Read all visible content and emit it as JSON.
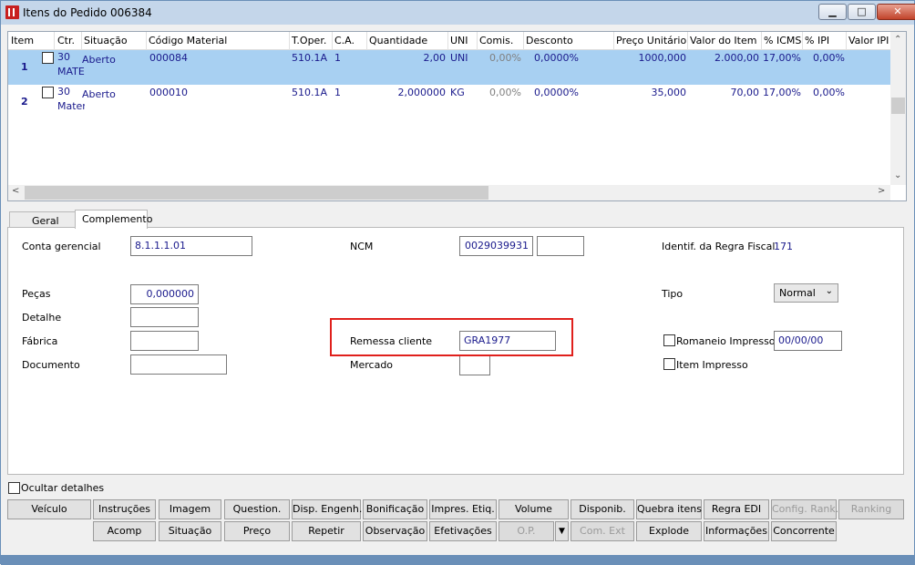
{
  "window": {
    "title": "Itens do Pedido 006384",
    "min": "▁",
    "max": "□",
    "close": "✕"
  },
  "grid": {
    "headers": [
      "Item",
      "Ctr.",
      "Situação",
      "Código Material",
      "T.Oper.",
      "C.A.",
      "Quantidade",
      "UNI",
      "Comis.",
      "Desconto",
      "Preço Unitário",
      "Valor do Item",
      "% ICMS",
      "% IPI",
      "Valor IPI"
    ],
    "rows": [
      {
        "item": "1",
        "ctr": "30",
        "ctr2": "MATE",
        "situacao": "Aberto",
        "codigo": "000084",
        "toper": "510.1A",
        "ca": "1",
        "quantidade": "2,00",
        "uni": "UNI",
        "comis": "0,00%",
        "desconto": "0,0000%",
        "preco": "1000,000",
        "valor": "2.000,00",
        "icms": "17,00%",
        "ipi": "0,00%"
      },
      {
        "item": "2",
        "ctr": "30",
        "ctr2": "Mater",
        "situacao": "Aberto",
        "codigo": "000010",
        "toper": "510.1A",
        "ca": "1",
        "quantidade": "2,000000",
        "uni": "KG",
        "comis": "0,00%",
        "desconto": "0,0000%",
        "preco": "35,000",
        "valor": "70,00",
        "icms": "17,00%",
        "ipi": "0,00%"
      }
    ]
  },
  "tabs": [
    "Geral",
    "Complemento"
  ],
  "form": {
    "conta_label": "Conta gerencial",
    "conta_value": "8.1.1.1.01",
    "ncm_label": "NCM",
    "ncm_value": "0029039931",
    "ncm_value2": "",
    "regra_label": "Identif. da Regra Fiscal",
    "regra_value": "171",
    "pecas_label": "Peças",
    "pecas_value": "0,000000",
    "tipo_label": "Tipo",
    "tipo_value": "Normal",
    "detalhe_label": "Detalhe",
    "fabrica_label": "Fábrica",
    "remessa_label": "Remessa cliente",
    "remessa_value": "GRA1977",
    "romaneio_label": "Romaneio Impresso",
    "romaneio_value": "00/00/00",
    "documento_label": "Documento",
    "mercado_label": "Mercado",
    "item_impresso_label": "Item Impresso"
  },
  "ocultar_label": "Ocultar detalhes",
  "buttons_row1": [
    "Veículo",
    "Instruções",
    "Imagem",
    "Question.",
    "Disp. Engenh.",
    "Bonificação",
    "Impres. Etiq.",
    "Volume",
    "Disponib.",
    "Quebra itens",
    "Regra EDI",
    "Config. Rank.",
    "Ranking"
  ],
  "buttons_row2": [
    "Acomp",
    "Situação",
    "Preço",
    "Repetir",
    "Observação",
    "Efetivações",
    "O.P.",
    "Com. Ext",
    "Explode",
    "Informações",
    "Concorrente"
  ]
}
